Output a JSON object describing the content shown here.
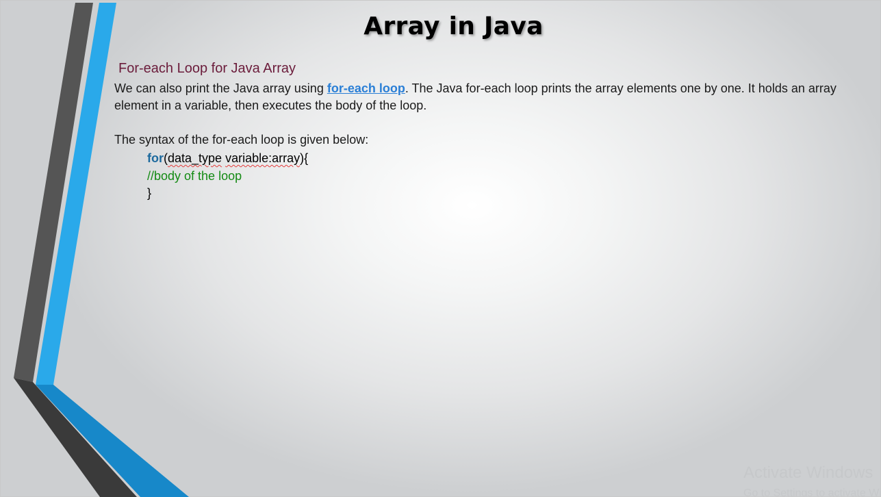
{
  "slide": {
    "title": "Array in Java",
    "subtitle": "For-each Loop for Java Array",
    "paragraph": {
      "before_link": "We can also print the Java array using ",
      "link_text": "for-each loop",
      "after_link": ". The Java for-each loop prints the array elements one by one. It holds an array element in a variable, then executes the body of the loop."
    },
    "syntax_intro": "The syntax of the for-each loop is given below:",
    "code": {
      "keyword": "for",
      "line1_rest_open": "(",
      "line1_squiggle1": "data_type",
      "line1_space": " ",
      "line1_squiggle2": "variable:array",
      "line1_close": "){",
      "line2": "//body of the loop",
      "line3": "}"
    }
  },
  "watermark": {
    "line1": "Activate Windows",
    "line2": "Go to Settings to activate Windows."
  },
  "colors": {
    "accent_blue": "#2aa9ea",
    "stripe_dark": "#555555",
    "subtitle": "#6b1c3b",
    "link": "#2a7fd6",
    "comment": "#138a13",
    "keyword": "#1d6a9e"
  }
}
